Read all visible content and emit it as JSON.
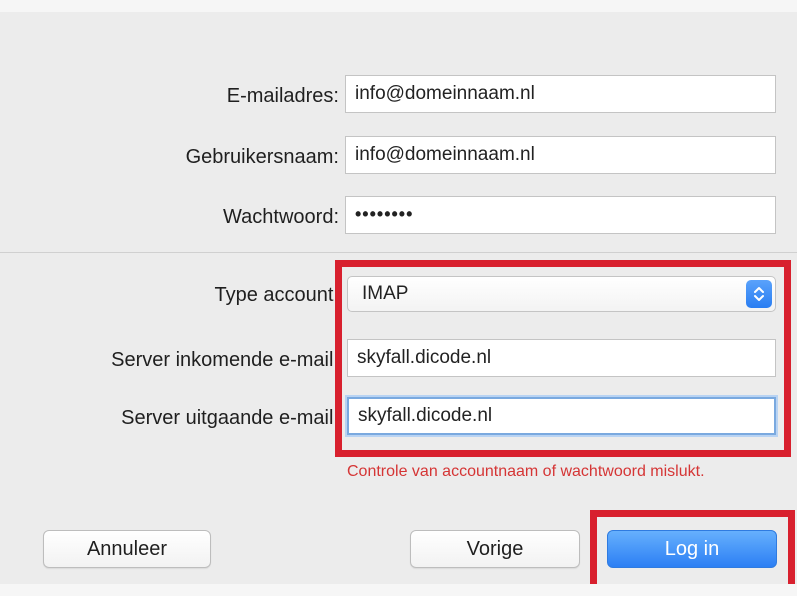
{
  "form": {
    "email_label": "E-mailadres:",
    "email_value": "info@domeinnaam.nl",
    "username_label": "Gebruikersnaam:",
    "username_value": "info@domeinnaam.nl",
    "password_label": "Wachtwoord:",
    "password_value": "••••••••",
    "account_type_label": "Type account:",
    "account_type_value": "IMAP",
    "incoming_label": "Server inkomende e-mail:",
    "incoming_value": "skyfall.dicode.nl",
    "outgoing_label": "Server uitgaande e-mail:",
    "outgoing_value": "skyfall.dicode.nl",
    "error_message": "Controle van accountnaam of wachtwoord mislukt."
  },
  "buttons": {
    "cancel_label": "Annuleer",
    "back_label": "Vorige",
    "login_label": "Log in"
  },
  "colors": {
    "highlight": "#d8202e",
    "error_text": "#d53535",
    "primary_button": "#2c7ff4"
  },
  "icons": {
    "select_stepper": "up-down-chevron-icon"
  }
}
